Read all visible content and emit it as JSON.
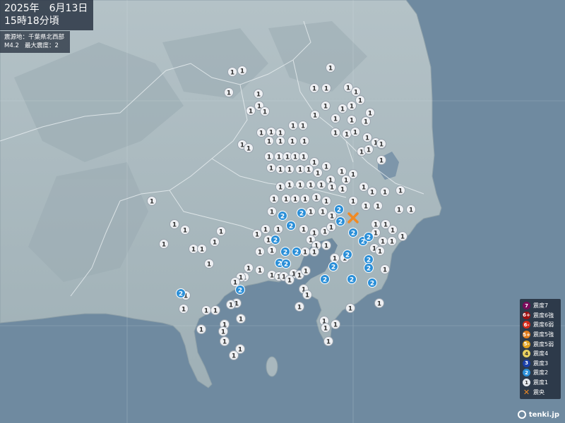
{
  "header": {
    "date": "2025年　6月13日",
    "time": "15時18分頃"
  },
  "quake": {
    "epicenter": "震源地：千葉県北西部",
    "magnitude": "M4.2",
    "max_intensity": "最大震度：2"
  },
  "legend": [
    {
      "glyph": "7",
      "label": "震度7",
      "color": "#7a0a5a"
    },
    {
      "glyph": "6+",
      "label": "震度6強",
      "color": "#a01010"
    },
    {
      "glyph": "6-",
      "label": "震度6弱",
      "color": "#d42a1a"
    },
    {
      "glyph": "5+",
      "label": "震度5強",
      "color": "#e07a1a"
    },
    {
      "glyph": "5-",
      "label": "震度5弱",
      "color": "#e0a020"
    },
    {
      "glyph": "4",
      "label": "震度4",
      "color": "#e8d060"
    },
    {
      "glyph": "3",
      "label": "震度3",
      "color": "#1a3fa8"
    },
    {
      "glyph": "2",
      "label": "震度2",
      "color": "#2a8fd8"
    },
    {
      "glyph": "1",
      "label": "震度1",
      "color": "#e6e9ee"
    },
    {
      "glyph": "✕",
      "label": "震央",
      "color": "#f08a24"
    }
  ],
  "brand": "tenki.jp",
  "markers_i2_label": "2",
  "markers_i1_label": "1"
}
